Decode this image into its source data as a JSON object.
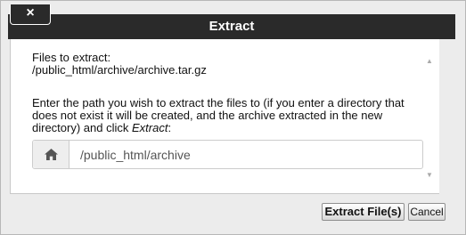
{
  "dialog": {
    "title": "Extract",
    "close_label": "×"
  },
  "content": {
    "files_label": "Files to extract:",
    "files_path": "/public_html/archive/archive.tar.gz",
    "instruction_lead": "Enter the path you wish to extract the files to (if you enter a directory that does not exist it will be created, and the archive extracted in the new directory) and click ",
    "instruction_action": "Extract",
    "instruction_end": ":"
  },
  "path_field": {
    "icon": "home-icon",
    "value": "/public_html/archive"
  },
  "scrollbar": {
    "up_glyph": "▲",
    "down_glyph": "▼"
  },
  "buttons": {
    "extract_label": "Extract File(s)",
    "cancel_label": "Cancel"
  }
}
